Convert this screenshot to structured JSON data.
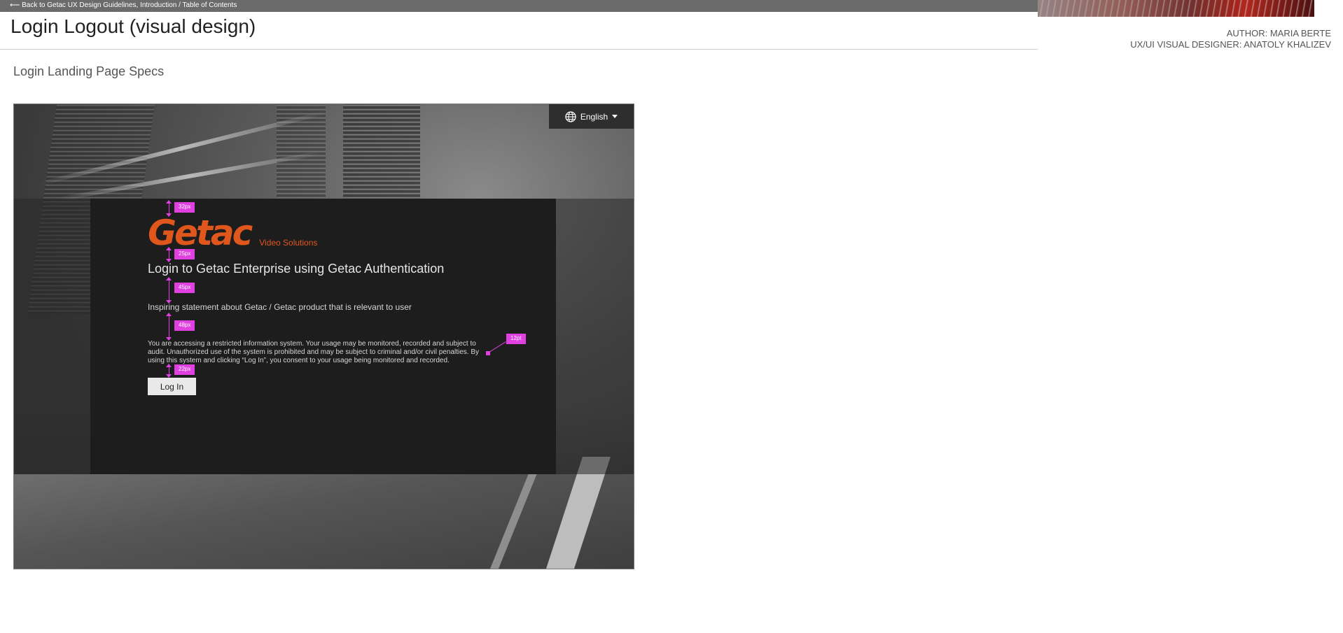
{
  "topbar": {
    "back_link": "⟵ Back to Getac UX Design Guidelines, Introduction / Table of Contents"
  },
  "header": {
    "title": "Login Logout (visual design)",
    "author": "AUTHOR: MARIA BERTE",
    "designer": "UX/UI VISUAL DESIGNER: ANATOLY KHALIZEV"
  },
  "section": {
    "title": "Login Landing Page Specs"
  },
  "mockup": {
    "language": {
      "label": "English",
      "icon": "globe-icon"
    },
    "logo": {
      "wordmark": "Getac",
      "subtitle": "Video Solutions"
    },
    "heading": "Login to Getac Enterprise using Getac Authentication",
    "statement": "Inspiring statement about Getac / Getac product that is relevant to user",
    "disclaimer": "You are accessing a restricted information system. Your usage may be monitored, recorded and subject to audit. Unauthorized use of the system is prohibited and may be subject to criminal and/or civil penalties. By using this system and clicking “Log In”, you consent to your usage being monitored and recorded.",
    "login_button": "Log In",
    "specs": [
      "32px",
      "25px",
      "45px",
      "48px",
      "22px",
      "12pt"
    ]
  },
  "colors": {
    "brand_orange": "#e0571d",
    "spec_magenta": "#e040e0",
    "panel": "#1d1d1e"
  }
}
